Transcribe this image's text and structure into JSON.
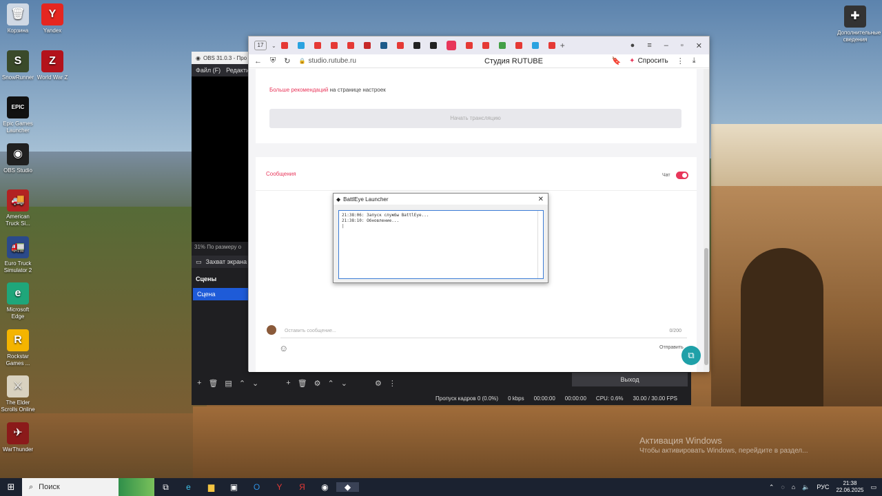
{
  "desktop": {
    "icons": [
      {
        "label": "Корзина",
        "color": "#cfd8e4",
        "glyph": "🗑"
      },
      {
        "label": "Yandex",
        "color": "#e52620",
        "glyph": "Y"
      },
      {
        "label": "SnowRunner",
        "color": "#3a4a2a",
        "glyph": "S"
      },
      {
        "label": "World War Z",
        "color": "#b3121b",
        "glyph": "Z"
      },
      {
        "label": "Epic Games Launcher",
        "color": "#111111",
        "glyph": "EPIC"
      },
      {
        "label": "OBS Studio",
        "color": "#202020",
        "glyph": "◉"
      },
      {
        "label": "American Truck Si...",
        "color": "#b22222",
        "glyph": "🚚"
      },
      {
        "label": "Euro Truck Simulator 2",
        "color": "#2b4a8a",
        "glyph": "🚛"
      },
      {
        "label": "Microsoft Edge",
        "color": "#1fa67a",
        "glyph": "e"
      },
      {
        "label": "Rockstar Games ...",
        "color": "#f4b400",
        "glyph": "R"
      },
      {
        "label": "The Elder Scrolls Online",
        "color": "#d9d2c0",
        "glyph": "⚔"
      },
      {
        "label": "WarThunder",
        "color": "#8b1a1a",
        "glyph": "✈"
      },
      {
        "label": "Дополнительные сведения",
        "color": "#333333",
        "glyph": "✚"
      }
    ],
    "watermark_title": "Активация Windows",
    "watermark_sub": "Чтобы активировать Windows, перейдите в раздел..."
  },
  "obs": {
    "title": "OBS 31.0.3 - Про",
    "menu": [
      "Файл (F)",
      "Редакти"
    ],
    "zoom_text": "31%  По размеру о",
    "capture_label": "Захват экрана",
    "scenes_header": "Сцены",
    "scene_name": "Сцена",
    "exit_label": "Выход",
    "status": {
      "dropped": "Пропуск кадров 0 (0.0%)",
      "kbps": "0 kbps",
      "rec_time": "00:00:00",
      "stream_time": "00:00:00",
      "cpu": "CPU: 0.6%",
      "fps": "30.00 / 30.00 FPS"
    }
  },
  "browser": {
    "tab_count": "17",
    "url": "studio.rutube.ru",
    "page_title": "Студия RUTUBE",
    "ask_label": "Спросить",
    "tab_colors": [
      "#e53935",
      "#2aa3e0",
      "#e53935",
      "#e53935",
      "#e53935",
      "#c62828",
      "#1c5a8a",
      "#e53935",
      "#222222",
      "#222222",
      "#666666",
      "#e53935",
      "#e53935",
      "#43a047",
      "#e53935",
      "#2aa3e0",
      "#e53935"
    ]
  },
  "studio": {
    "recommend_link": "Больше рекомендаций",
    "recommend_rest": " на странице настроек",
    "start_button": "Начать трансляцию",
    "messages_title": "Сообщения",
    "chat_label": "Чат",
    "message_placeholder": "Оставить сообщение...",
    "message_counter": "0/200",
    "send_label": "Отправить"
  },
  "battleye": {
    "title": "BattlEye Launcher",
    "log": [
      "21:38:06: Запуск службы BattlEye...",
      "21:38:10: Обновление...",
      "|"
    ]
  },
  "taskbar": {
    "search_label": "Поиск",
    "lang": "РУС",
    "time": "21:38",
    "date": "22.06.2025"
  }
}
